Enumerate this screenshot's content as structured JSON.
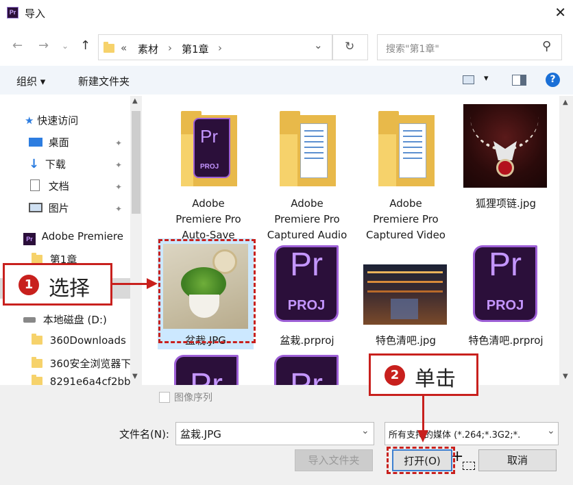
{
  "window": {
    "title": "导入",
    "close_glyph": "✕",
    "logo": "Pr"
  },
  "address": {
    "back": "←",
    "forward": "→",
    "up": "↑",
    "chevrons": "«",
    "sep": "›",
    "crumbs": [
      "素材",
      "第1章"
    ],
    "dropdown": "⌄",
    "refresh": "↻",
    "search_placeholder": "搜索\"第1章\"",
    "search_icon": "⚲"
  },
  "toolbar": {
    "organize": "组织 ▾",
    "new_folder": "新建文件夹",
    "view_arrow": "▾",
    "help": "?"
  },
  "sidebar": {
    "items": [
      {
        "label": "快速访问",
        "icon": "star-icon"
      },
      {
        "label": "桌面",
        "icon": "desktop-icon",
        "pinned": true
      },
      {
        "label": "下载",
        "icon": "download-icon",
        "pinned": true
      },
      {
        "label": "文档",
        "icon": "document-icon",
        "pinned": true
      },
      {
        "label": "图片",
        "icon": "pictures-icon",
        "pinned": true
      },
      {
        "label": "Adobe Premiere",
        "icon": "premiere-icon"
      },
      {
        "label": "第1章",
        "icon": "folder-icon"
      },
      {
        "label": "本地磁盘 (D:)",
        "icon": "drive-icon"
      },
      {
        "label": "360Downloads",
        "icon": "folder-icon"
      },
      {
        "label": "360安全浏览器下",
        "icon": "folder-icon"
      },
      {
        "label": "8291e6a4cf2bb",
        "icon": "folder-icon"
      }
    ]
  },
  "files": [
    {
      "name": "Adobe Premiere Pro Auto-Save",
      "lines": [
        "Adobe",
        "Premiere Pro",
        "Auto-Save"
      ],
      "type": "folder-prproj"
    },
    {
      "name": "Adobe Premiere Pro Captured Audio",
      "lines": [
        "Adobe",
        "Premiere Pro",
        "Captured Audio"
      ],
      "type": "folder-doc"
    },
    {
      "name": "Adobe Premiere Pro Captured Video",
      "lines": [
        "Adobe",
        "Premiere Pro",
        "Captured Video"
      ],
      "type": "folder-doc"
    },
    {
      "name": "狐狸项链.jpg",
      "lines": [
        "狐狸项链.jpg"
      ],
      "type": "image"
    },
    {
      "name": "盆栽.JPG",
      "lines": [
        "盆栽.JPG"
      ],
      "type": "image",
      "selected": true
    },
    {
      "name": "盆栽.prproj",
      "lines": [
        "盆栽.prproj"
      ],
      "type": "proj"
    },
    {
      "name": "特色清吧.jpg",
      "lines": [
        "特色清吧.jpg"
      ],
      "type": "image"
    },
    {
      "name": "特色清吧.prproj",
      "lines": [
        "特色清吧.prproj"
      ],
      "type": "proj"
    }
  ],
  "proj_icon": {
    "pr": "Pr",
    "proj": "PROJ"
  },
  "bottom": {
    "sequence_label": "图像序列",
    "filename_label": "文件名(N):",
    "filename_value": "盆栽.JPG",
    "filetype_value": "所有支持的媒体 (*.264;*.3G2;*.",
    "import_folder": "导入文件夹",
    "open": "打开(O)",
    "cancel": "取消"
  },
  "callouts": [
    {
      "num": "1",
      "text": "选择"
    },
    {
      "num": "2",
      "text": "单击"
    }
  ],
  "colors": {
    "accent": "#c8201d",
    "selection": "#cce8ff",
    "toolbar": "#f1f5fa"
  }
}
